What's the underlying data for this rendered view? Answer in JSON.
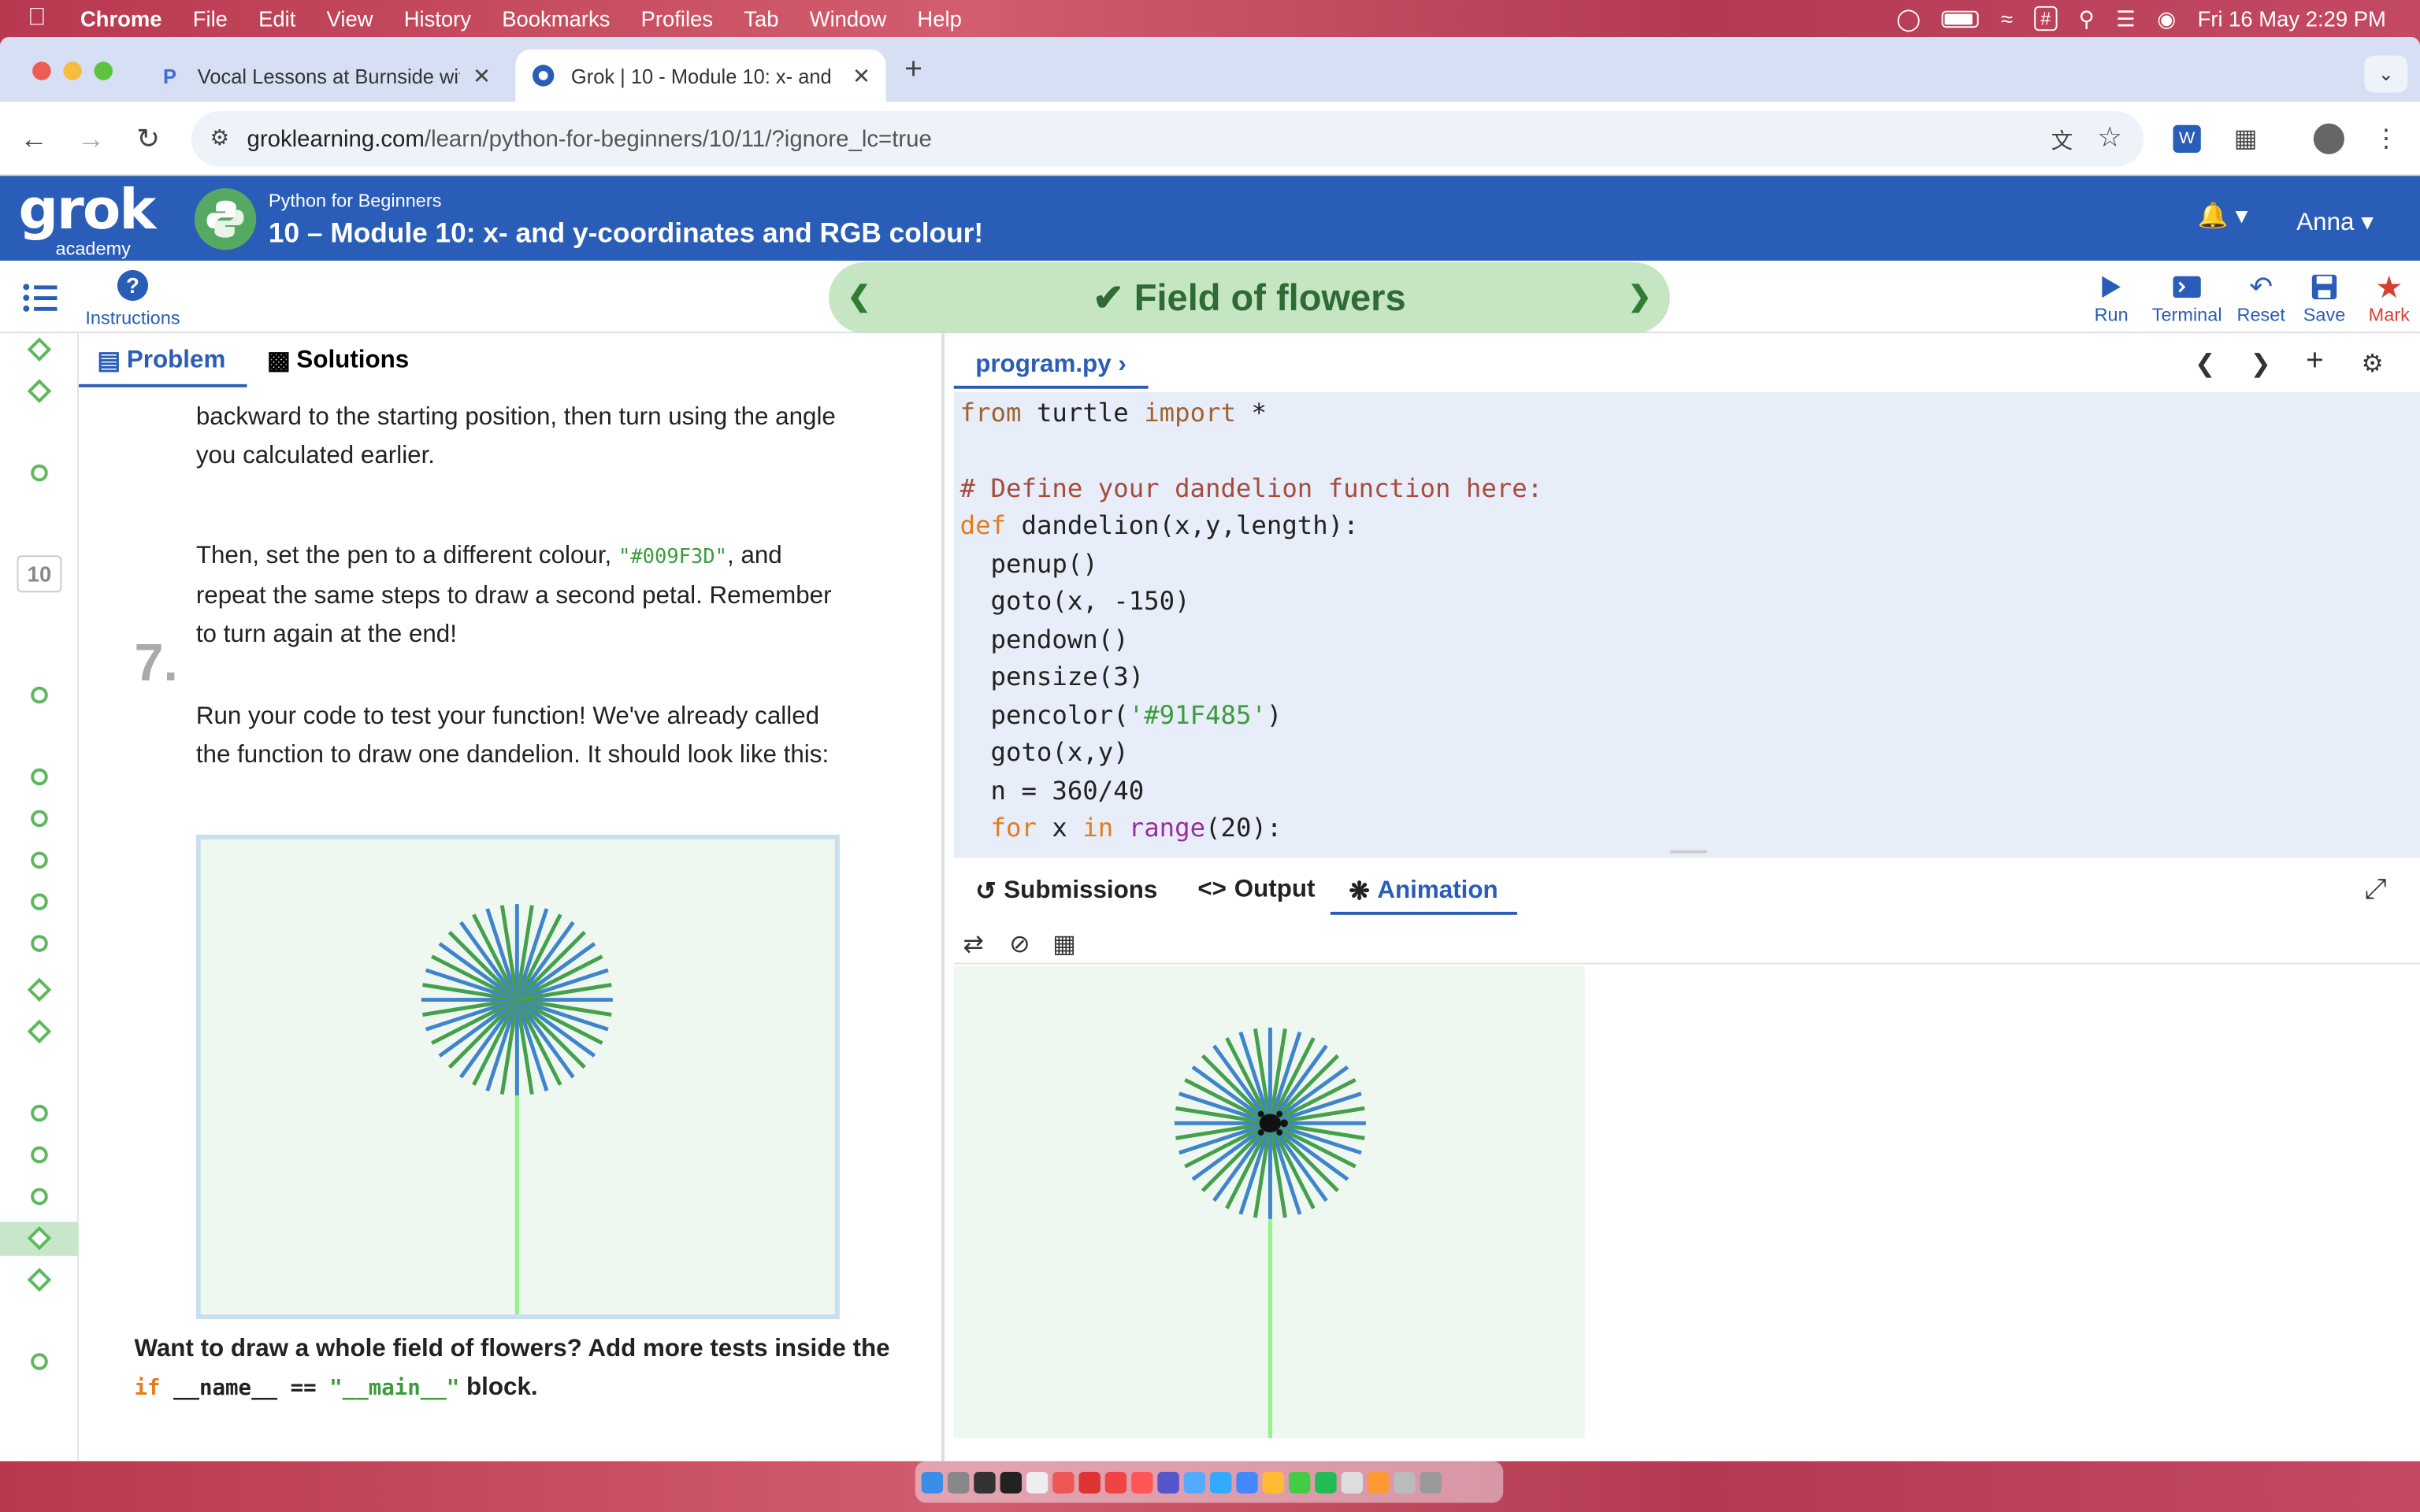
{
  "menubar": {
    "app": "Chrome",
    "items": [
      "File",
      "Edit",
      "View",
      "History",
      "Bookmarks",
      "Profiles",
      "Tab",
      "Window",
      "Help"
    ],
    "datetime": "Fri 16 May  2:29 PM"
  },
  "tabs": [
    {
      "title": "Vocal Lessons at Burnside wit"
    },
    {
      "title": "Grok | 10 - Module 10: x- and"
    }
  ],
  "address": {
    "domain": "groklearning.com",
    "path": "/learn/python-for-beginners/10/11/?ignore_lc=true"
  },
  "header": {
    "logo_main": "grok",
    "logo_sub": "academy",
    "course": "Python for Beginners",
    "module": "10 – Module 10: x- and y-coordinates and RGB colour!",
    "user": "Anna"
  },
  "subbar": {
    "instructions": "Instructions",
    "title": "Field of flowers",
    "actions": [
      "Run",
      "Terminal",
      "Reset",
      "Save",
      "Mark"
    ]
  },
  "sidebar": {
    "step_number": "10"
  },
  "left": {
    "tabs": [
      "Problem",
      "Solutions"
    ],
    "para1": "backward to the starting position, then turn using the angle you calculated earlier.",
    "para2_pre": "Then, set the pen to a different colour, ",
    "para2_code": "\"#009F3D\"",
    "para2_post": ", and repeat the same steps to draw a second petal. Remember to turn again at the end!",
    "step7_num": "7.",
    "step7": "Run your code to test your function! We've already called the function to draw one dandelion. It should look like this:",
    "final_pre": "Want to draw a whole field of flowers? Add more tests inside the ",
    "final_kw": "if",
    "final_mid": " __name__ == ",
    "final_str": "\"__main__\"",
    "final_post": " block."
  },
  "editor": {
    "filename": "program.py",
    "lines": {
      "l1_kw1": "from",
      "l1_mid": " turtle ",
      "l1_kw2": "import",
      "l1_rest": " *",
      "l3": "# Define your dandelion function here:",
      "l4_kw": "def",
      "l4_rest": " dandelion(x,y,length):",
      "l5": "  penup()",
      "l6": "  goto(x, -150)",
      "l7": "  pendown()",
      "l8": "  pensize(3)",
      "l9_a": "  pencolor(",
      "l9_s": "'#91F485'",
      "l9_b": ")",
      "l10": "  goto(x,y)",
      "l11": "  n = 360/40",
      "l12_k1": "  for",
      "l12_a": " x ",
      "l12_k2": "in",
      "l12_sp": " ",
      "l12_b": "range",
      "l12_c": "(20):"
    }
  },
  "output": {
    "tabs": [
      "Submissions",
      "Output",
      "Animation"
    ]
  },
  "colors": {
    "petal_blue": "#3f84cc",
    "petal_green": "#44a04a",
    "stem": "#91F485",
    "brand": "#2a5db7"
  }
}
